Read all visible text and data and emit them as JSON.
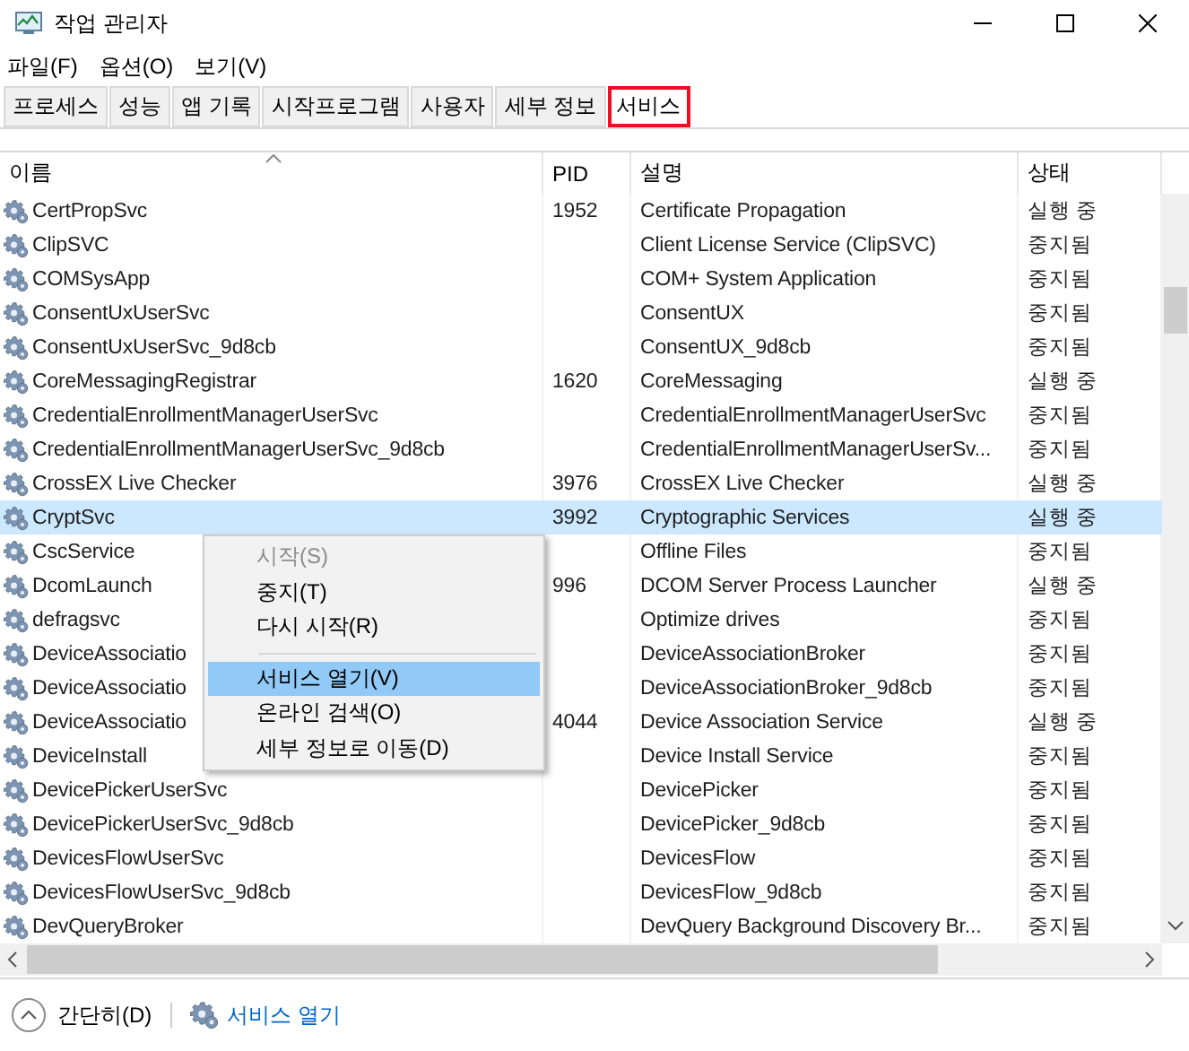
{
  "window": {
    "title": "작업 관리자"
  },
  "menu": [
    "파일(F)",
    "옵션(O)",
    "보기(V)"
  ],
  "tabs": [
    {
      "label": "프로세스",
      "selected": false,
      "annotated": false
    },
    {
      "label": "성능",
      "selected": false,
      "annotated": false
    },
    {
      "label": "앱 기록",
      "selected": false,
      "annotated": false
    },
    {
      "label": "시작프로그램",
      "selected": false,
      "annotated": false
    },
    {
      "label": "사용자",
      "selected": false,
      "annotated": false
    },
    {
      "label": "세부 정보",
      "selected": false,
      "annotated": false
    },
    {
      "label": "서비스",
      "selected": true,
      "annotated": true
    }
  ],
  "table": {
    "columns": [
      "이름",
      "PID",
      "설명",
      "상태"
    ],
    "rows": [
      {
        "name": "CertPropSvc",
        "pid": "1952",
        "description": "Certificate Propagation",
        "status": "실행 중",
        "selected": false
      },
      {
        "name": "ClipSVC",
        "pid": "",
        "description": "Client License Service (ClipSVC)",
        "status": "중지됨",
        "selected": false
      },
      {
        "name": "COMSysApp",
        "pid": "",
        "description": "COM+ System Application",
        "status": "중지됨",
        "selected": false
      },
      {
        "name": "ConsentUxUserSvc",
        "pid": "",
        "description": "ConsentUX",
        "status": "중지됨",
        "selected": false
      },
      {
        "name": "ConsentUxUserSvc_9d8cb",
        "pid": "",
        "description": "ConsentUX_9d8cb",
        "status": "중지됨",
        "selected": false
      },
      {
        "name": "CoreMessagingRegistrar",
        "pid": "1620",
        "description": "CoreMessaging",
        "status": "실행 중",
        "selected": false
      },
      {
        "name": "CredentialEnrollmentManagerUserSvc",
        "pid": "",
        "description": "CredentialEnrollmentManagerUserSvc",
        "status": "중지됨",
        "selected": false
      },
      {
        "name": "CredentialEnrollmentManagerUserSvc_9d8cb",
        "pid": "",
        "description": "CredentialEnrollmentManagerUserSv...",
        "status": "중지됨",
        "selected": false
      },
      {
        "name": "CrossEX Live Checker",
        "pid": "3976",
        "description": "CrossEX Live Checker",
        "status": "실행 중",
        "selected": false
      },
      {
        "name": "CryptSvc",
        "pid": "3992",
        "description": "Cryptographic Services",
        "status": "실행 중",
        "selected": true
      },
      {
        "name": "CscService",
        "pid": "",
        "description": "Offline Files",
        "status": "중지됨",
        "selected": false
      },
      {
        "name": "DcomLaunch",
        "pid": "996",
        "description": "DCOM Server Process Launcher",
        "status": "실행 중",
        "selected": false
      },
      {
        "name": "defragsvc",
        "pid": "",
        "description": "Optimize drives",
        "status": "중지됨",
        "selected": false
      },
      {
        "name": "DeviceAssociatio",
        "pid": "",
        "description": "DeviceAssociationBroker",
        "status": "중지됨",
        "selected": false
      },
      {
        "name": "DeviceAssociatio",
        "pid": "",
        "description": "DeviceAssociationBroker_9d8cb",
        "status": "중지됨",
        "selected": false
      },
      {
        "name": "DeviceAssociatio",
        "pid": "4044",
        "description": "Device Association Service",
        "status": "실행 중",
        "selected": false
      },
      {
        "name": "DeviceInstall",
        "pid": "",
        "description": "Device Install Service",
        "status": "중지됨",
        "selected": false
      },
      {
        "name": "DevicePickerUserSvc",
        "pid": "",
        "description": "DevicePicker",
        "status": "중지됨",
        "selected": false
      },
      {
        "name": "DevicePickerUserSvc_9d8cb",
        "pid": "",
        "description": "DevicePicker_9d8cb",
        "status": "중지됨",
        "selected": false
      },
      {
        "name": "DevicesFlowUserSvc",
        "pid": "",
        "description": "DevicesFlow",
        "status": "중지됨",
        "selected": false
      },
      {
        "name": "DevicesFlowUserSvc_9d8cb",
        "pid": "",
        "description": "DevicesFlow_9d8cb",
        "status": "중지됨",
        "selected": false
      },
      {
        "name": "DevQueryBroker",
        "pid": "",
        "description": "DevQuery Background Discovery Br...",
        "status": "중지됨",
        "selected": false
      }
    ]
  },
  "context_menu": [
    {
      "kind": "item",
      "label": "시작(S)",
      "disabled": true,
      "selected": false
    },
    {
      "kind": "item",
      "label": "중지(T)",
      "disabled": false,
      "selected": false
    },
    {
      "kind": "item",
      "label": "다시 시작(R)",
      "disabled": false,
      "selected": false
    },
    {
      "kind": "separator"
    },
    {
      "kind": "item",
      "label": "서비스 열기(V)",
      "disabled": false,
      "selected": true
    },
    {
      "kind": "item",
      "label": "온라인 검색(O)",
      "disabled": false,
      "selected": false
    },
    {
      "kind": "item",
      "label": "세부 정보로 이동(D)",
      "disabled": false,
      "selected": false
    }
  ],
  "footer": {
    "collapse": "간단히(D)",
    "link": "서비스 열기"
  }
}
